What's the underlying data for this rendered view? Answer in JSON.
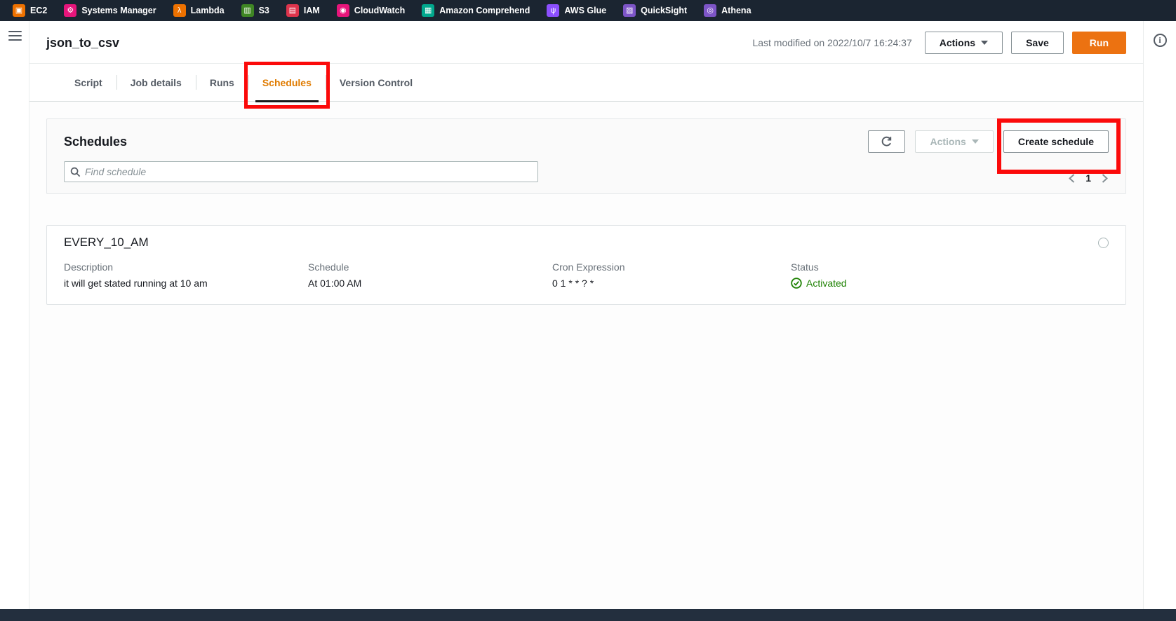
{
  "topbar": {
    "services": [
      {
        "label": "EC2",
        "color": "#ed7100",
        "glyph": "▣"
      },
      {
        "label": "Systems Manager",
        "color": "#e7157b",
        "glyph": "⚙"
      },
      {
        "label": "Lambda",
        "color": "#ed7100",
        "glyph": "λ"
      },
      {
        "label": "S3",
        "color": "#3f8624",
        "glyph": "▥"
      },
      {
        "label": "IAM",
        "color": "#dd344c",
        "glyph": "▤"
      },
      {
        "label": "CloudWatch",
        "color": "#e7157b",
        "glyph": "◉"
      },
      {
        "label": "Amazon Comprehend",
        "color": "#01a88d",
        "glyph": "▦"
      },
      {
        "label": "AWS Glue",
        "color": "#8c4fff",
        "glyph": "ψ"
      },
      {
        "label": "QuickSight",
        "color": "#7d55c7",
        "glyph": "▨"
      },
      {
        "label": "Athena",
        "color": "#7d55c7",
        "glyph": "◎"
      }
    ]
  },
  "header": {
    "title": "json_to_csv",
    "last_modified": "Last modified on 2022/10/7 16:24:37",
    "actions_label": "Actions",
    "save_label": "Save",
    "run_label": "Run"
  },
  "tabs": [
    {
      "label": "Script"
    },
    {
      "label": "Job details"
    },
    {
      "label": "Runs"
    },
    {
      "label": "Schedules",
      "active": true
    },
    {
      "label": "Version Control"
    }
  ],
  "schedules_panel": {
    "title": "Schedules",
    "search_placeholder": "Find schedule",
    "actions_label": "Actions",
    "create_label": "Create schedule",
    "page": "1"
  },
  "schedule_card": {
    "name": "EVERY_10_AM",
    "fields": [
      {
        "label": "Description",
        "value": "it will get stated running at 10 am"
      },
      {
        "label": "Schedule",
        "value": "At 01:00 AM"
      },
      {
        "label": "Cron Expression",
        "value": "0 1 * * ? *"
      },
      {
        "label": "Status",
        "value": "Activated"
      }
    ]
  },
  "colors": {
    "topbar_bg": "#1b2531",
    "primary_orange": "#ec7211",
    "active_tab_orange": "#e07b00",
    "status_green": "#1d8102",
    "annotation_red": "#fb0a0a"
  }
}
